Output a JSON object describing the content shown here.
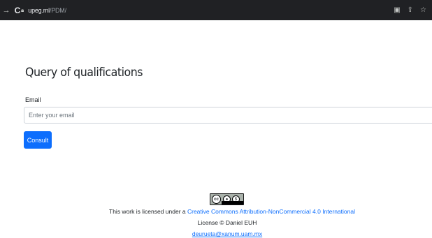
{
  "browser": {
    "back_icon": "arrow-left",
    "reload_icon": "reload",
    "lock_icon": "lock",
    "host": "upeg.ml",
    "path": "/PDM/",
    "extension_icon": "extension",
    "share_icon": "share",
    "star_icon": "star"
  },
  "form": {
    "title": "Query of qualifications",
    "email_label": "Email",
    "email_placeholder": "Enter your email",
    "email_value": "",
    "submit_label": "Consult"
  },
  "footer": {
    "badge_icon": "creative-commons-by-nc-badge",
    "license_prefix": "This work is licensed under a ",
    "license_link": "Creative Commons Attribution-NonCommercial 4.0 International",
    "copyright": "License © Daniel EUH",
    "contact_email": "deurueta@xanum.uam.mx"
  },
  "colors": {
    "accent": "#0d6efd",
    "chrome_bar": "#202124"
  }
}
